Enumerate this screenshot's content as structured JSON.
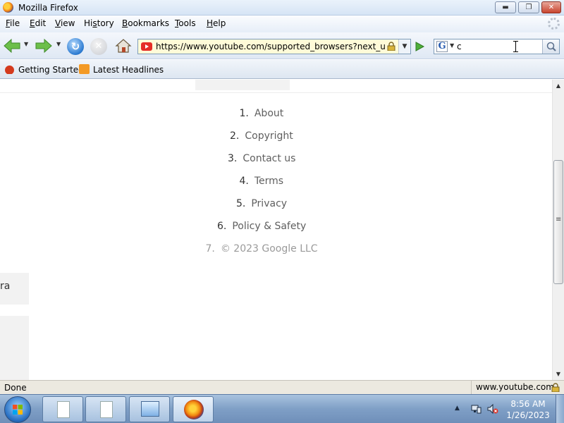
{
  "window": {
    "title": "Mozilla Firefox",
    "min_glyph": "▬",
    "max_glyph": "❐",
    "close_glyph": "✕"
  },
  "menubar": {
    "items": [
      {
        "key": "F",
        "rest": "ile"
      },
      {
        "key": "E",
        "rest": "dit"
      },
      {
        "key": "V",
        "rest": "iew"
      },
      {
        "pre": "Hi",
        "key": "s",
        "rest": "tory"
      },
      {
        "key": "B",
        "rest": "ookmarks"
      },
      {
        "key": "T",
        "rest": "ools"
      },
      {
        "key": "H",
        "rest": "elp"
      }
    ]
  },
  "toolbar": {
    "url": "https://www.youtube.com/supported_browsers?next_url=htt",
    "search_engine_letter": "G",
    "search_value": "c",
    "dropdown_glyph": "▼",
    "reload_glyph": "↻",
    "stop_glyph": "✕",
    "go_glyph": "▶",
    "search_glyph": "⌕"
  },
  "bookmarks": {
    "items": [
      "Getting Started",
      "Latest Headlines"
    ]
  },
  "page": {
    "footer_links": [
      {
        "num": "1.",
        "label": "About",
        "muted": false
      },
      {
        "num": "2.",
        "label": "Copyright",
        "muted": false
      },
      {
        "num": "3.",
        "label": "Contact us",
        "muted": false
      },
      {
        "num": "4.",
        "label": "Terms",
        "muted": false
      },
      {
        "num": "5.",
        "label": "Privacy",
        "muted": false
      },
      {
        "num": "6.",
        "label": "Policy & Safety",
        "muted": false
      },
      {
        "num": "7.",
        "label": "© 2023 Google LLC",
        "muted": true
      }
    ],
    "side_fragment": "ra"
  },
  "statusbar": {
    "status": "Done",
    "domain": "www.youtube.com"
  },
  "taskbar": {
    "time": "8:56 AM",
    "date": "1/26/2023",
    "tray_arrow": "▲"
  },
  "scrollbar": {
    "up_glyph": "▲",
    "down_glyph": "▼",
    "position_fraction": 0.45
  },
  "colors": {
    "accent": "#2c7bd1",
    "url_bg": "#fffbd8",
    "youtube_red": "#e52d27",
    "close_red": "#c8452f"
  }
}
